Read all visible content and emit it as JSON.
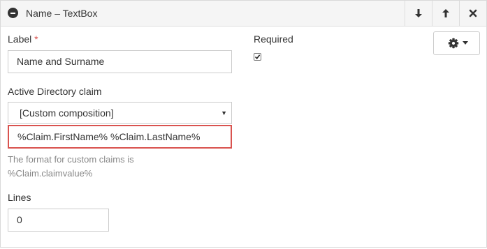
{
  "header": {
    "title": "Name – TextBox",
    "icons": {
      "collapse": "minus-circle-icon",
      "move_down": "arrow-down-icon",
      "move_up": "arrow-up-icon",
      "remove": "close-icon"
    }
  },
  "form": {
    "label": {
      "text": "Label",
      "required_mark": "*",
      "value": "Name and Surname"
    },
    "required": {
      "text": "Required",
      "checked": true
    },
    "ad_claim": {
      "text": "Active Directory claim",
      "selected": "[Custom composition]",
      "composition_value": "%Claim.FirstName% %Claim.LastName%",
      "help_line1": "The format for custom claims is",
      "help_line2": "%Claim.claimvalue%"
    },
    "lines": {
      "text": "Lines",
      "value": "0"
    }
  },
  "settings": {
    "icon": "gear-icon",
    "caret": "caret-down-icon"
  },
  "colors": {
    "highlight_border": "#d9534f",
    "required_mark": "#d9534f",
    "help_text": "#888888"
  }
}
